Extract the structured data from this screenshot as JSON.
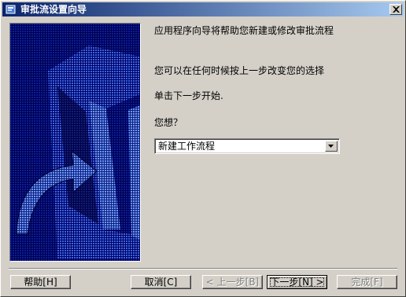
{
  "window": {
    "title": "审批流设置向导",
    "close_icon": "close-icon",
    "app_icon": "app-icon"
  },
  "side_art": {
    "icon": "wizard-book-arrow-illustration"
  },
  "content": {
    "intro": "应用程序向导将帮助您新建或修改审批流程",
    "back_hint": "您可以在任何时候按上一步改变您的选择",
    "next_hint": "单击下一步开始.",
    "question": "您想？"
  },
  "combo": {
    "selected": "新建工作流程",
    "arrow_icon": "chevron-down-icon"
  },
  "buttons": {
    "help": "帮助[H]",
    "cancel": "取消[C]",
    "back": "< 上一步[B]",
    "next": "下一步[N] >",
    "finish": "完成[F]"
  }
}
